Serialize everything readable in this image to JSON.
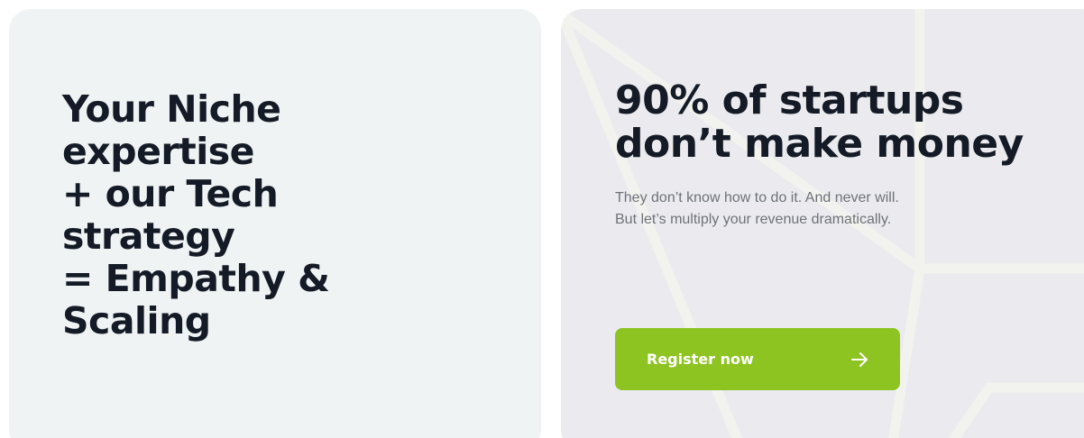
{
  "left_card": {
    "headline": "Your Niche\nexpertise\n+ our Tech\nstrategy\n= Empathy &\nScaling"
  },
  "right_card": {
    "title": "90% of startups\ndon’t make money",
    "subtitle": "They don’t know how to do it. And never will.\nBut let’s multiply your revenue dramatically.",
    "cta": {
      "label": "Register now",
      "icon": "arrow-right-icon"
    }
  },
  "colors": {
    "left_card_bg": "#eff3f4",
    "right_card_bg": "#ebebef",
    "heading_text": "#141b26",
    "body_text": "#6d7178",
    "accent_green": "#8dc421"
  }
}
